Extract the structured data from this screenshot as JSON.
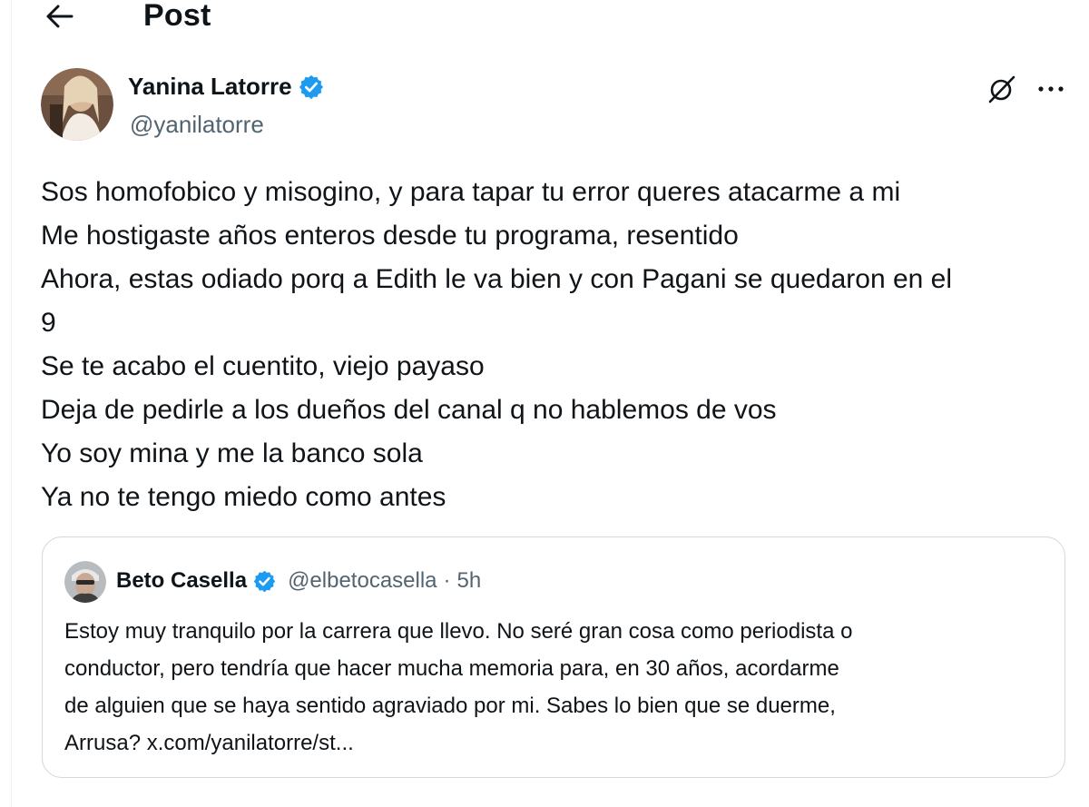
{
  "header": {
    "title": "Post",
    "back_icon": "arrow-left-icon"
  },
  "author": {
    "name": "Yanina Latorre",
    "handle": "@yanilatorre",
    "verified": true,
    "verified_color": "#1d9bf0"
  },
  "actions": {
    "grok_icon": "grok-icon",
    "more_icon": "more-icon"
  },
  "tweet": {
    "lines": [
      "Sos homofobico y misogino, y para tapar tu error queres atacarme a mi",
      "Me hostigaste años enteros desde tu programa, resentido",
      "Ahora, estas odiado porq a Edith le va bien y con Pagani se quedaron en el",
      "9",
      "Se te acabo el cuentito, viejo payaso",
      "Deja de pedirle a los dueños del canal q no hablemos de vos",
      "Yo soy mina y me la banco sola",
      "Ya no te tengo miedo como antes"
    ]
  },
  "quote": {
    "name": "Beto Casella",
    "handle": "@elbetocasella",
    "separator": "·",
    "time": "5h",
    "verified": true,
    "lines": [
      "Estoy muy tranquilo por la carrera que llevo. No seré gran cosa como periodista o",
      "conductor, pero tendría que hacer mucha memoria para, en 30 años, acordarme",
      "de alguien que se haya sentido agraviado por mi. Sabes lo bien que se duerme,",
      "Arrusa? x.com/yanilatorre/st..."
    ]
  },
  "colors": {
    "text": "#0f1419",
    "secondary": "#536471",
    "border": "#cfd9de",
    "accent": "#1d9bf0"
  }
}
